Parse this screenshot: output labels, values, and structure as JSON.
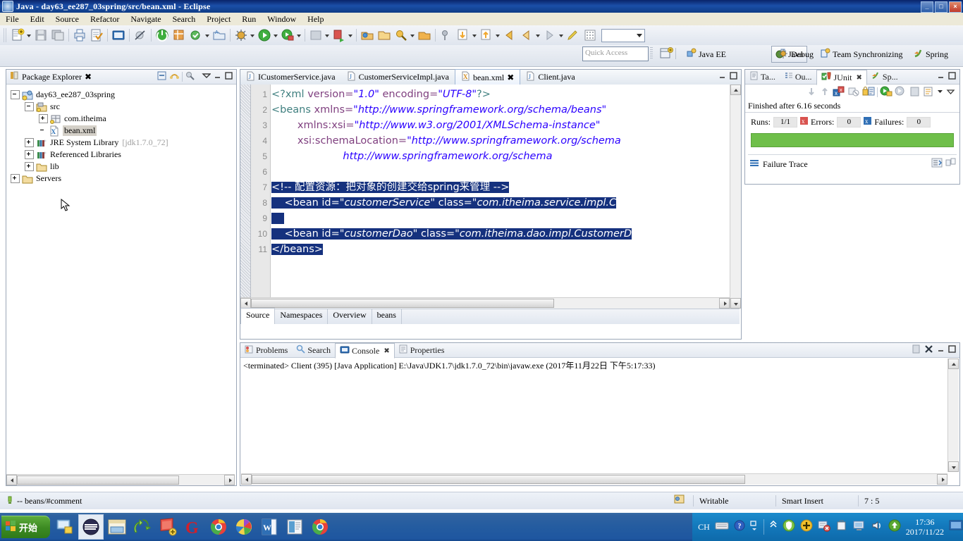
{
  "window": {
    "title": "Java - day63_ee287_03spring/src/bean.xml - Eclipse",
    "minimize": "_",
    "maximize": "□",
    "close": "×"
  },
  "menu": [
    "File",
    "Edit",
    "Source",
    "Refactor",
    "Navigate",
    "Search",
    "Project",
    "Run",
    "Window",
    "Help"
  ],
  "quick_access": {
    "placeholder": "Quick Access"
  },
  "perspectives": [
    {
      "label": "Java EE",
      "active": false
    },
    {
      "label": "Java",
      "active": true
    },
    {
      "label": "Debug",
      "active": false
    },
    {
      "label": "Team Synchronizing",
      "active": false
    },
    {
      "label": "Spring",
      "active": false
    }
  ],
  "package_explorer": {
    "title": "Package Explorer",
    "close": "✖",
    "tree": [
      {
        "label": "day63_ee287_03spring",
        "indent": 0,
        "expander": "minus",
        "icon": "project-icon"
      },
      {
        "label": "src",
        "indent": 1,
        "expander": "minus",
        "icon": "source-folder-icon"
      },
      {
        "label": "com.itheima",
        "indent": 2,
        "expander": "plus",
        "icon": "package-icon"
      },
      {
        "label": "bean.xml",
        "indent": 2,
        "expander": "none",
        "icon": "xml-file-icon",
        "selected": true
      },
      {
        "label": "JRE System Library",
        "suffix": "[jdk1.7.0_72]",
        "indent": 1,
        "expander": "plus",
        "icon": "library-icon"
      },
      {
        "label": "Referenced Libraries",
        "indent": 1,
        "expander": "plus",
        "icon": "library-icon"
      },
      {
        "label": "lib",
        "indent": 1,
        "expander": "plus",
        "icon": "folder-icon"
      },
      {
        "label": "Servers",
        "indent": 0,
        "expander": "plus",
        "icon": "folder-icon"
      }
    ]
  },
  "editor": {
    "tabs": [
      {
        "label": "ICustomerService.java",
        "icon": "java-file-icon",
        "active": false
      },
      {
        "label": "CustomerServiceImpl.java",
        "icon": "java-file-icon",
        "active": false
      },
      {
        "label": "bean.xml",
        "icon": "xml-file-icon",
        "active": true,
        "close": "✖"
      },
      {
        "label": "Client.java",
        "icon": "java-file-icon",
        "active": false
      }
    ],
    "line_numbers": [
      "1",
      "2",
      "3",
      "4",
      "5",
      "6",
      "7",
      "8",
      "9",
      "10",
      "11"
    ],
    "code_lines": [
      {
        "n": 1,
        "selected": false,
        "segments": [
          {
            "t": "<?xml ",
            "c": "tag"
          },
          {
            "t": "version=",
            "c": "attr"
          },
          {
            "t": "\"1.0\"",
            "c": "val"
          },
          {
            "t": " ",
            "c": "plain"
          },
          {
            "t": "encoding=",
            "c": "attr"
          },
          {
            "t": "\"UTF-8\"",
            "c": "val"
          },
          {
            "t": "?>",
            "c": "tag"
          }
        ]
      },
      {
        "n": 2,
        "selected": false,
        "fold": true,
        "segments": [
          {
            "t": "<beans ",
            "c": "tag"
          },
          {
            "t": "xmlns=",
            "c": "attr"
          },
          {
            "t": "\"http://www.springframework.org/schema/beans\"",
            "c": "val"
          }
        ]
      },
      {
        "n": 3,
        "selected": false,
        "segments": [
          {
            "t": "        ",
            "c": "plain"
          },
          {
            "t": "xmlns:xsi=",
            "c": "attr"
          },
          {
            "t": "\"http://www.w3.org/2001/XMLSchema-instance\"",
            "c": "val"
          }
        ]
      },
      {
        "n": 4,
        "selected": false,
        "segments": [
          {
            "t": "        ",
            "c": "plain"
          },
          {
            "t": "xsi:schemaLocation=",
            "c": "attr"
          },
          {
            "t": "\"http://www.springframework.org/schema",
            "c": "val"
          }
        ]
      },
      {
        "n": 5,
        "selected": false,
        "segments": [
          {
            "t": "                      ",
            "c": "plain"
          },
          {
            "t": "http://www.springframework.org/schema",
            "c": "val"
          }
        ]
      },
      {
        "n": 6,
        "selected": false,
        "segments": []
      },
      {
        "n": 7,
        "selected": true,
        "indent_plain": "  ",
        "segments": [
          {
            "t": "<!-- 配置资源：把对象的创建交给spring来管理 -->",
            "c": "cmt"
          }
        ]
      },
      {
        "n": 8,
        "selected": true,
        "segments": [
          {
            "t": "    ",
            "c": "plain"
          },
          {
            "t": "<bean ",
            "c": "tag"
          },
          {
            "t": "id=",
            "c": "attr"
          },
          {
            "t": "\"customerService\"",
            "c": "val"
          },
          {
            "t": " ",
            "c": "plain"
          },
          {
            "t": "class=",
            "c": "attr"
          },
          {
            "t": "\"com.itheima.service.impl.C",
            "c": "val"
          }
        ]
      },
      {
        "n": 9,
        "selected": true,
        "segments": []
      },
      {
        "n": 10,
        "selected": true,
        "segments": [
          {
            "t": "    ",
            "c": "plain"
          },
          {
            "t": "<bean ",
            "c": "tag"
          },
          {
            "t": "id=",
            "c": "attr"
          },
          {
            "t": "\"customerDao\"",
            "c": "val"
          },
          {
            "t": " ",
            "c": "plain"
          },
          {
            "t": "class=",
            "c": "attr"
          },
          {
            "t": "\"com.itheima.dao.impl.CustomerD",
            "c": "val"
          }
        ]
      },
      {
        "n": 11,
        "selected": true,
        "segments": [
          {
            "t": "</beans>",
            "c": "tag"
          }
        ]
      }
    ],
    "bottom_tabs": [
      {
        "label": "Source",
        "active": true
      },
      {
        "label": "Namespaces",
        "active": false
      },
      {
        "label": "Overview",
        "active": false
      },
      {
        "label": "beans",
        "active": false
      }
    ]
  },
  "junit": {
    "tabs": [
      {
        "label": "Ta...",
        "icon": "tasks-icon",
        "active": false
      },
      {
        "label": "Ou...",
        "icon": "outline-icon",
        "active": false
      },
      {
        "label": "JUnit",
        "icon": "junit-icon",
        "active": true,
        "close": "✖"
      },
      {
        "label": "Sp...",
        "icon": "spring-icon",
        "active": false
      }
    ],
    "status": "Finished after 6.16 seconds",
    "runs_label": "Runs:",
    "runs_value": "1/1",
    "errors_label": "Errors:",
    "errors_value": "0",
    "failures_label": "Failures:",
    "failures_value": "0",
    "progress_color": "#6fbf4a",
    "failure_trace_label": "Failure Trace"
  },
  "console": {
    "tabs": [
      {
        "label": "Problems",
        "icon": "problems-icon",
        "active": false
      },
      {
        "label": "Search",
        "icon": "search-icon",
        "active": false
      },
      {
        "label": "Console",
        "icon": "console-icon",
        "active": true,
        "close": "✖"
      },
      {
        "label": "Properties",
        "icon": "properties-icon",
        "active": false
      }
    ],
    "output": "<terminated> Client (395) [Java Application] E:\\Java\\JDK1.7\\jdk1.7.0_72\\bin\\javaw.exe (2017年11月22日 下午5:17:33)"
  },
  "statusbar": {
    "path": "-- beans/#comment",
    "writable": "Writable",
    "insert_mode": "Smart Insert",
    "position": "7 : 5"
  },
  "taskbar": {
    "start": "开始",
    "items": [
      {
        "name": "computer-icon",
        "active": false
      },
      {
        "name": "eclipse-icon",
        "active": true
      },
      {
        "name": "explorer-icon",
        "active": false
      },
      {
        "name": "recycle-icon",
        "active": false
      },
      {
        "name": "notes-icon",
        "active": false
      },
      {
        "name": "gamepad-icon",
        "active": false
      },
      {
        "name": "chrome-icon",
        "active": false
      },
      {
        "name": "color-icon",
        "active": false
      },
      {
        "name": "word-icon",
        "active": false
      },
      {
        "name": "ppt-icon",
        "active": false
      },
      {
        "name": "chrome2-icon",
        "active": false
      }
    ],
    "ime": "CH",
    "time": "17:36",
    "date": "2017/11/22"
  }
}
